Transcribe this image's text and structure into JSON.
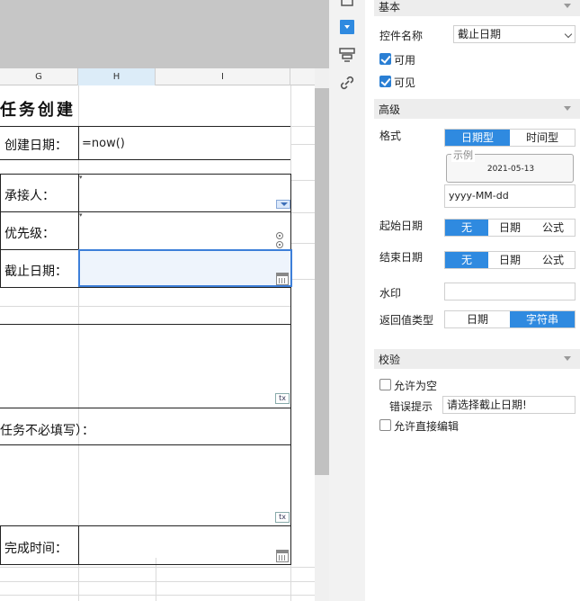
{
  "sheet": {
    "columns": [
      "G",
      "H",
      "I"
    ],
    "title": "任务创建",
    "create_date_label": "创建日期：",
    "create_date_formula": "=now()",
    "assignee_label": "承接人：",
    "priority_label": "优先级：",
    "deadline_label": "截止日期：",
    "optional_note": "任务不必填写）：",
    "finish_time_label": "完成时间：",
    "tx_label": "tx"
  },
  "panel": {
    "basic": {
      "title": "基本",
      "control_name_label": "控件名称",
      "control_name_value": "截止日期",
      "enabled_label": "可用",
      "enabled": true,
      "visible_label": "可见",
      "visible": true
    },
    "advanced": {
      "title": "高级",
      "format_label": "格式",
      "format_options": [
        "日期型",
        "时间型"
      ],
      "format_selected": "日期型",
      "example_legend": "示例",
      "example_value": "2021-05-13",
      "pattern_value": "yyyy-MM-dd",
      "start_date_label": "起始日期",
      "start_options": [
        "无",
        "日期",
        "公式"
      ],
      "start_selected": "无",
      "end_date_label": "结束日期",
      "end_options": [
        "无",
        "日期",
        "公式"
      ],
      "end_selected": "无",
      "watermark_label": "水印",
      "watermark_value": "",
      "return_type_label": "返回值类型",
      "return_options": [
        "日期",
        "字符串"
      ],
      "return_selected": "字符串"
    },
    "validation": {
      "title": "校验",
      "allow_empty_label": "允许为空",
      "allow_empty": false,
      "error_tip_label": "错误提示",
      "error_tip_value": "请选择截止日期!",
      "allow_direct_edit_label": "允许直接编辑",
      "allow_direct_edit": false
    }
  },
  "colors": {
    "accent": "#2f8ae0",
    "selection_border": "#3d7fd9",
    "selection_fill": "#eef4fc",
    "section_header_bg": "#ededed"
  },
  "icons": [
    "widget-dropdown-icon",
    "layer-icon",
    "link-icon",
    "calendar-icon",
    "tx-icon",
    "radio-icon"
  ]
}
